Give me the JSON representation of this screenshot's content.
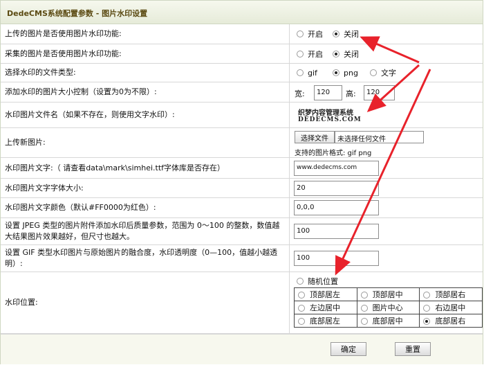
{
  "header": {
    "title": "DedeCMS系统配置参数 - 图片水印设置"
  },
  "rows": {
    "upload_watermark": {
      "label": "上传的图片是否使用图片水印功能:",
      "opt_on": "开启",
      "opt_off": "关闭",
      "selected": "关闭"
    },
    "collect_watermark": {
      "label": "采集的图片是否使用图片水印功能:",
      "opt_on": "开启",
      "opt_off": "关闭",
      "selected": "关闭"
    },
    "file_type": {
      "label": "选择水印的文件类型:",
      "opt_gif": "gif",
      "opt_png": "png",
      "opt_text": "文字",
      "selected": "png"
    },
    "size_limit": {
      "label": "添加水印的图片大小控制（设置为0为不限）:",
      "width_label": "宽:",
      "width_value": "120",
      "height_label": "高:",
      "height_value": "120"
    },
    "image_file": {
      "label": "水印图片文件名（如果不存在，则使用文字水印）:",
      "preview_line1": "织梦内容管理系统",
      "preview_line2": "DEDECMS.COM"
    },
    "upload_new": {
      "label": "上传新图片:",
      "button": "选择文件",
      "status": "未选择任何文件",
      "formats": "支持的图片格式: gif png"
    },
    "text": {
      "label": "水印图片文字:（  请查看data\\mark\\simhei.ttf字体库是否存在）",
      "value": "www.dedecms.com"
    },
    "font_size": {
      "label": "水印图片文字字体大小:",
      "value": "20"
    },
    "font_color": {
      "label": "水印图片文字颜色（默认#FF0000为红色）:",
      "value": "0,0,0"
    },
    "jpeg_quality": {
      "label": "设置 JPEG 类型的图片附件添加水印后质量参数，范围为 0～100 的整数，数值越大结果图片效果越好，但尺寸也越大。",
      "value": "100"
    },
    "gif_alpha": {
      "label": "设置 GIF 类型水印图片与原始图片的融合度，水印透明度（0—100，值越小越透明）:",
      "value": "100"
    },
    "position": {
      "label": "水印位置:",
      "random": "随机位置",
      "cells": [
        [
          "顶部居左",
          "顶部居中",
          "顶部居右"
        ],
        [
          "左边居中",
          "图片中心",
          "右边居中"
        ],
        [
          "底部居左",
          "底部居中",
          "底部居右"
        ]
      ],
      "selected": "底部居右"
    }
  },
  "actions": {
    "confirm": "确定",
    "reset": "重置"
  },
  "colors": {
    "annotation_arrow": "#e8222b",
    "header_text": "#5b4a12"
  }
}
